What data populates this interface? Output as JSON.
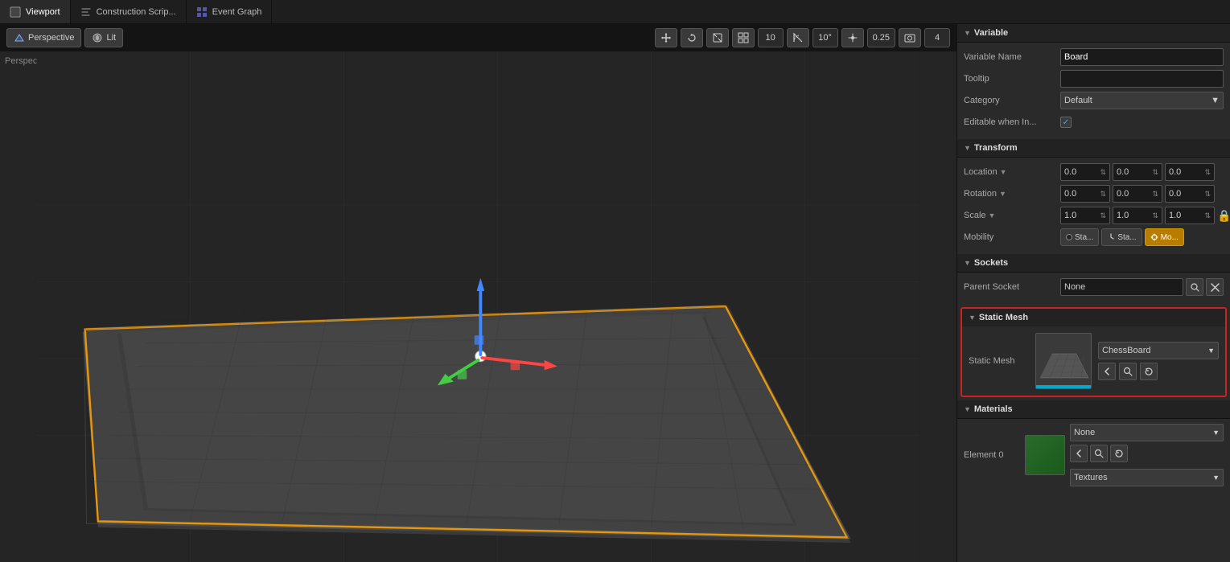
{
  "tabs": [
    {
      "id": "viewport",
      "label": "Viewport",
      "icon": "viewport-icon",
      "active": true
    },
    {
      "id": "construction-script",
      "label": "Construction Scrip...",
      "icon": "script-icon",
      "active": false
    },
    {
      "id": "event-graph",
      "label": "Event Graph",
      "icon": "graph-icon",
      "active": false
    }
  ],
  "viewport": {
    "perspective_label": "Perspective",
    "lit_label": "Lit"
  },
  "toolbar": {
    "btn_10_label": "10",
    "btn_angle_label": "10°",
    "btn_scale_label": "0.25",
    "btn_4_label": "4"
  },
  "right_panel": {
    "variable_section": {
      "title": "Variable",
      "variable_name_label": "Variable Name",
      "variable_name_value": "Board",
      "tooltip_label": "Tooltip",
      "tooltip_value": "",
      "category_label": "Category",
      "category_value": "Default",
      "editable_label": "Editable when In...",
      "editable_checked": true
    },
    "transform_section": {
      "title": "Transform",
      "location_label": "Location",
      "rotation_label": "Rotation",
      "scale_label": "Scale",
      "mobility_label": "Mobility",
      "location_x": "0.0",
      "location_y": "0.0",
      "location_z": "0.0",
      "rotation_x": "0.0",
      "rotation_y": "0.0",
      "rotation_z": "0.0",
      "scale_x": "1.0",
      "scale_y": "1.0",
      "scale_z": "1.0",
      "mobility_static_label": "Sta...",
      "mobility_stationary_label": "Sta...",
      "mobility_movable_label": "Mo...",
      "mobility_active": "movable"
    },
    "sockets_section": {
      "title": "Sockets",
      "parent_socket_label": "Parent Socket",
      "parent_socket_value": "None"
    },
    "static_mesh_section": {
      "title": "Static Mesh",
      "static_mesh_label": "Static Mesh",
      "mesh_name": "ChessBoard",
      "highlighted": true
    },
    "materials_section": {
      "title": "Materials",
      "element0_label": "Element 0",
      "element0_value": "None",
      "material_dropdown": "None",
      "textures_label": "Textures"
    }
  }
}
